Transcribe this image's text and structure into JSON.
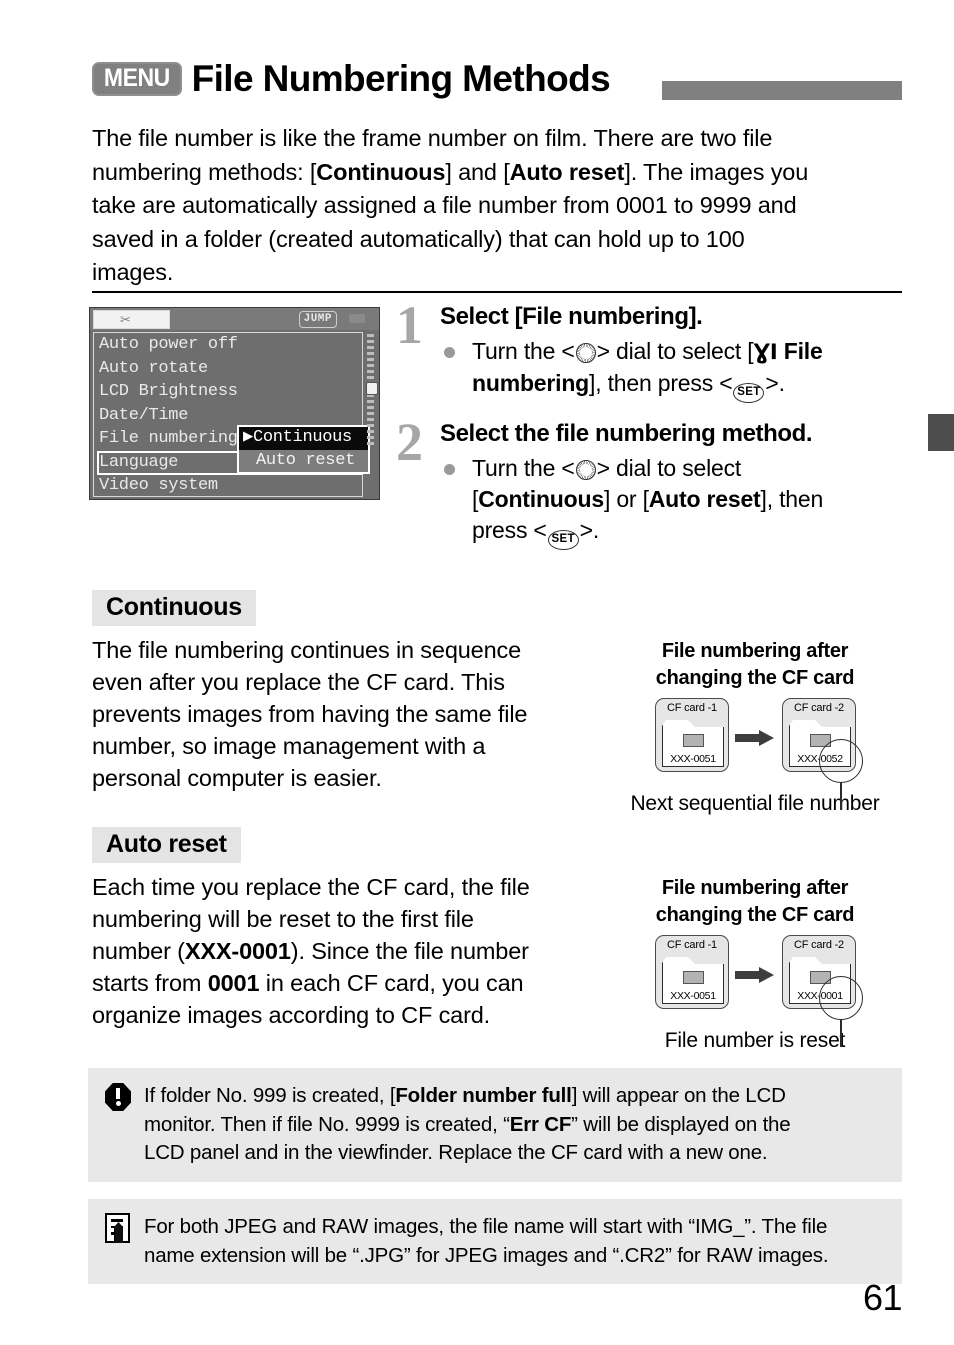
{
  "header": {
    "menu_badge": "MENU",
    "title": "File Numbering Methods"
  },
  "intro": {
    "l1_a": "The file number is like the frame number on film. There are two file",
    "l2_a": "numbering methods: [",
    "l2_b": "Continuous",
    "l2_c": "] and [",
    "l2_d": "Auto reset",
    "l2_e": "]. The images you",
    "l3": "take are automatically assigned a file number from 0001 to 9999 and",
    "l4": "saved in a folder (created automatically) that can hold up to 100",
    "l5": "images."
  },
  "lcd": {
    "tab_icon": "wrench-icon",
    "jump_label": "JUMP",
    "rows": [
      "Auto power off",
      "Auto rotate",
      "LCD Brightness",
      "Date/Time",
      "File numbering",
      "Language",
      "Video system"
    ],
    "popup": {
      "selected": "Continuous",
      "selected_marker": "▶",
      "other": "Auto reset"
    }
  },
  "steps": [
    {
      "number": "1",
      "title": "Select [File numbering].",
      "body": {
        "p1": "Turn the <",
        "dial": "dial-icon",
        "p2": "> dial to select [",
        "wrench": "ƔΙ",
        "bold1": "File numbering",
        "p3": "], then press <",
        "set": "SET",
        "p4": ">."
      }
    },
    {
      "number": "2",
      "title": "Select the file numbering method.",
      "body": {
        "p1": "Turn the <",
        "dial": "dial-icon",
        "p2": "> dial to select",
        "bold1": "Continuous",
        "mid": "] or [",
        "bold2": "Auto reset",
        "p3": "], then",
        "p4": "press <",
        "set": "SET",
        "p5": ">."
      }
    }
  ],
  "sections": [
    {
      "heading": "Continuous",
      "body_lines": [
        "The file numbering continues in sequence",
        "even after you replace the CF card. This",
        "prevents images from having the same file",
        "number, so image management with a",
        "personal computer is easier."
      ]
    },
    {
      "heading": "Auto reset",
      "body": {
        "l1": "Each time you replace the CF card, the file",
        "l2": "numbering will be reset to the first file",
        "l3_a": "number (",
        "l3_b": "XXX-0001",
        "l3_c": "). Since the file number",
        "l4_a": "starts from ",
        "l4_b": "0001",
        "l4_c": " in each CF card, you can",
        "l5": "organize images according to CF card."
      }
    }
  ],
  "diagrams": [
    {
      "title_l1": "File numbering after",
      "title_l2": "changing the CF card",
      "card1_label": "CF card -1",
      "card1_number": "XXX-0051",
      "card2_label": "CF card -2",
      "card2_number": "XXX-0052",
      "caption": "Next sequential file number"
    },
    {
      "title_l1": "File numbering after",
      "title_l2": "changing the CF card",
      "card1_label": "CF card -1",
      "card1_number": "XXX-0051",
      "card2_label": "CF card -2",
      "card2_number": "XXX-0001",
      "caption": "File number is reset"
    }
  ],
  "notes": [
    {
      "icon": "warning-icon",
      "l1_a": "If folder No. 999 is created, [",
      "l1_b": "Folder number full",
      "l1_c": "] will appear on the LCD",
      "l2_a": "monitor. Then if file No. 9999 is created, “",
      "l2_b": "Err CF",
      "l2_c": "” will be displayed on the",
      "l3": "LCD panel and in the viewfinder. Replace the CF card with a new one."
    },
    {
      "icon": "note-icon",
      "l1": "For both JPEG and RAW images, the file name will start with “IMG_”. The file",
      "l2": "name extension will be “.JPG” for JPEG images and “.CR2” for RAW images."
    }
  ],
  "page_number": "61",
  "colors": {
    "accent_gray": "#808080",
    "tab_gray": "#4d4d4d",
    "heading_bg": "#e4e4e4",
    "note_bg": "#e8e8e8"
  }
}
